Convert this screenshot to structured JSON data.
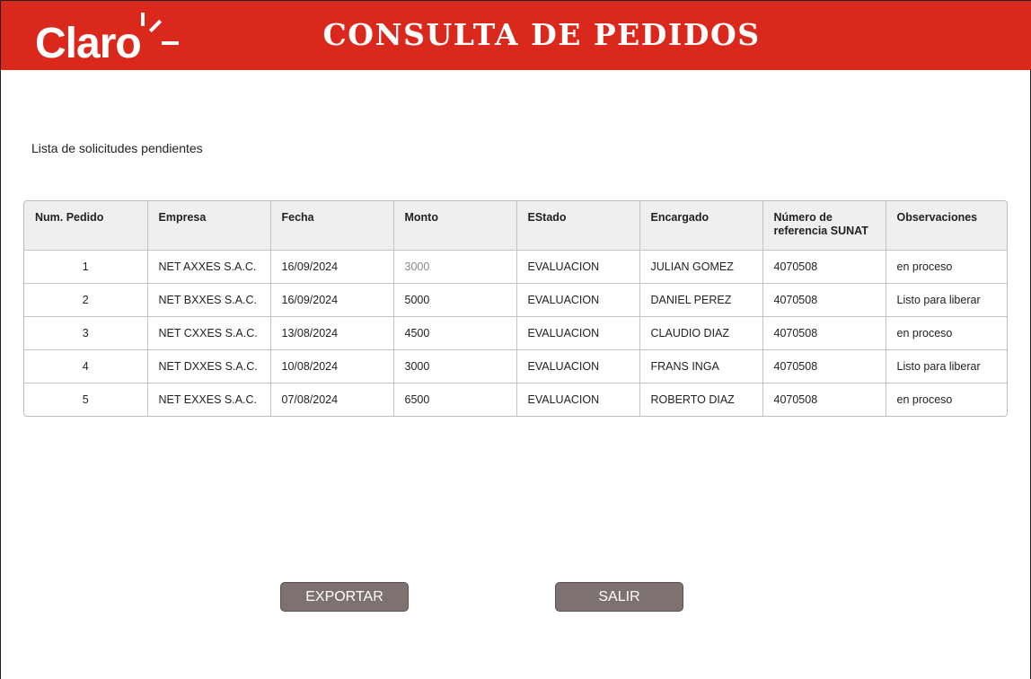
{
  "header": {
    "logo_text": "Claro",
    "title": "CONSULTA DE PEDIDOS",
    "brand_color": "#da291c"
  },
  "subtitle": "Lista de solicitudes pendientes",
  "table": {
    "columns": [
      "Num. Pedido",
      "Empresa",
      "Fecha",
      "Monto",
      "EStado",
      "Encargado",
      "Número de referencia SUNAT",
      "Observaciones"
    ],
    "rows": [
      [
        "1",
        "NET AXXES S.A.C.",
        "16/09/2024",
        "3000",
        "EVALUACION",
        "JULIAN GOMEZ",
        "4070508",
        "en proceso"
      ],
      [
        "2",
        "NET BXXES S.A.C.",
        "16/09/2024",
        "5000",
        "EVALUACION",
        "DANIEL PEREZ",
        "4070508",
        "Listo para liberar"
      ],
      [
        "3",
        "NET CXXES S.A.C.",
        "13/08/2024",
        "4500",
        "EVALUACION",
        "CLAUDIO DIAZ",
        "4070508",
        "en proceso"
      ],
      [
        "4",
        "NET DXXES S.A.C.",
        "10/08/2024",
        "3000",
        "EVALUACION",
        "FRANS INGA",
        "4070508",
        "Listo para liberar"
      ],
      [
        "5",
        "NET EXXES S.A.C.",
        "07/08/2024",
        "6500",
        "EVALUACION",
        "ROBERTO DIAZ",
        "4070508",
        "en proceso"
      ]
    ]
  },
  "buttons": {
    "export_label": "EXPORTAR",
    "exit_label": "SALIR"
  }
}
